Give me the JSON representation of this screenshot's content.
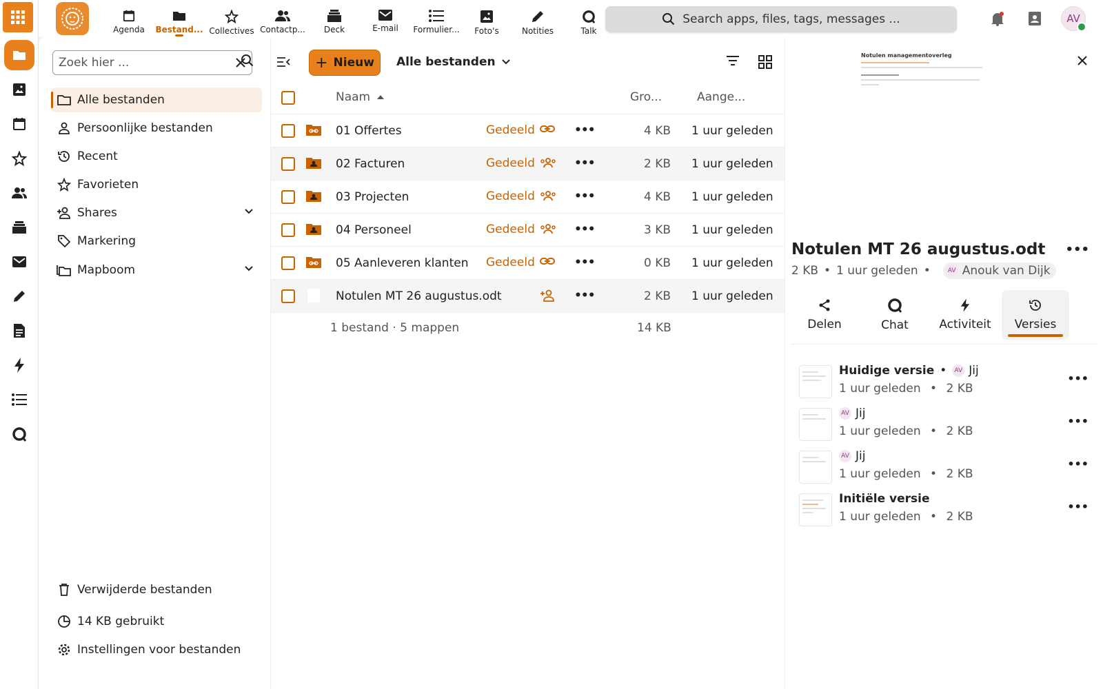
{
  "header": {
    "apps": [
      {
        "label": "Agenda",
        "icon": "calendar-icon"
      },
      {
        "label": "Bestand...",
        "icon": "folder-icon",
        "active": true
      },
      {
        "label": "Collectives",
        "icon": "collectives-icon"
      },
      {
        "label": "Contactp...",
        "icon": "contacts-icon"
      },
      {
        "label": "Deck",
        "icon": "deck-icon"
      },
      {
        "label": "E-mail",
        "icon": "mail-icon"
      },
      {
        "label": "Formulier...",
        "icon": "forms-icon"
      },
      {
        "label": "Foto's",
        "icon": "photo-icon"
      },
      {
        "label": "Notities",
        "icon": "pencil-icon"
      },
      {
        "label": "Talk",
        "icon": "talk-icon"
      }
    ],
    "search_placeholder": "Search apps, files, tags, messages ...",
    "avatar_initials": "AV",
    "accent": "#e8811c"
  },
  "navigation": {
    "filter_placeholder": "Zoek hier ...",
    "items": [
      {
        "label": "Alle bestanden",
        "icon": "folder-icon",
        "active": true
      },
      {
        "label": "Persoonlijke bestanden",
        "icon": "person-icon"
      },
      {
        "label": "Recent",
        "icon": "history-icon"
      },
      {
        "label": "Favorieten",
        "icon": "star-icon"
      },
      {
        "label": "Shares",
        "icon": "share-person-icon",
        "expandable": true
      },
      {
        "label": "Markering",
        "icon": "tag-icon"
      },
      {
        "label": "Mapboom",
        "icon": "folder-tree-icon",
        "expandable": true
      }
    ],
    "footer": {
      "trash": "Verwijderde bestanden",
      "quota": "14 KB gebruikt",
      "settings": "Instellingen voor bestanden"
    }
  },
  "files": {
    "new_label": "Nieuw",
    "breadcrumb": "Alle bestanden",
    "columns": {
      "name": "Naam",
      "size": "Gro...",
      "modified": "Aange..."
    },
    "rows": [
      {
        "name": "01 Offertes",
        "shared": "Gedeeld",
        "share_type": "link",
        "size": "4 KB",
        "modified": "1 uur geleden",
        "kind": "folder-link"
      },
      {
        "name": "02 Facturen",
        "shared": "Gedeeld",
        "share_type": "group",
        "size": "2 KB",
        "modified": "1 uur geleden",
        "kind": "folder-shared"
      },
      {
        "name": "03 Projecten",
        "shared": "Gedeeld",
        "share_type": "group",
        "size": "4 KB",
        "modified": "1 uur geleden",
        "kind": "folder-shared"
      },
      {
        "name": "04 Personeel",
        "shared": "Gedeeld",
        "share_type": "group",
        "size": "3 KB",
        "modified": "1 uur geleden",
        "kind": "folder-shared"
      },
      {
        "name": "05 Aanleveren klanten",
        "shared": "Gedeeld",
        "share_type": "link",
        "size": "0 KB",
        "modified": "1 uur geleden",
        "kind": "folder-link"
      },
      {
        "name": "Notulen MT 26 augustus.odt",
        "shared": "",
        "share_type": "add",
        "size": "2 KB",
        "modified": "1 uur geleden",
        "kind": "document"
      }
    ],
    "summary": "1 bestand · 5 mappen",
    "summary_size": "14 KB"
  },
  "sidebar": {
    "preview_title": "Notulen managementoverleg",
    "title": "Notulen MT 26 augustus.odt",
    "size": "2 KB",
    "modified": "1 uur geleden",
    "owner_initials": "AV",
    "owner": "Anouk van Dijk",
    "tabs": [
      {
        "label": "Delen",
        "icon": "share-icon"
      },
      {
        "label": "Chat",
        "icon": "talk-icon"
      },
      {
        "label": "Activiteit",
        "icon": "lightning-icon"
      },
      {
        "label": "Versies",
        "icon": "history-icon",
        "active": true
      }
    ],
    "versions": [
      {
        "title": "Huidige versie",
        "author_initials": "AV",
        "author": "Jij",
        "time": "1 uur geleden",
        "size": "2 KB"
      },
      {
        "title": "",
        "author_initials": "AV",
        "author": "Jij",
        "time": "1 uur geleden",
        "size": "2 KB"
      },
      {
        "title": "",
        "author_initials": "AV",
        "author": "Jij",
        "time": "1 uur geleden",
        "size": "2 KB"
      },
      {
        "title": "Initiële versie",
        "author_initials": "",
        "author": "",
        "time": "1 uur geleden",
        "size": "2 KB"
      }
    ]
  }
}
